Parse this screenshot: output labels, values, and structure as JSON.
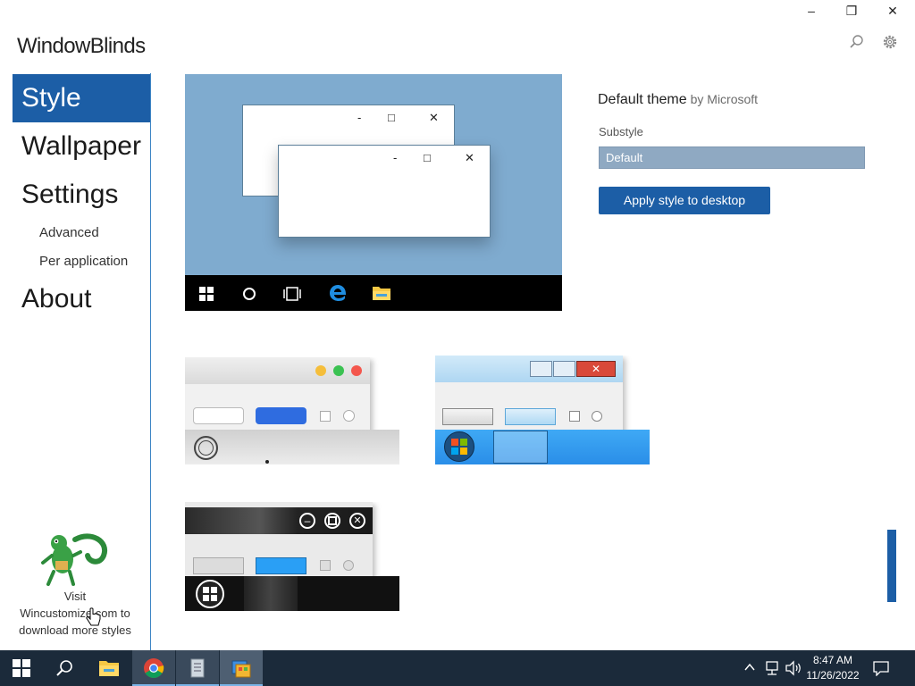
{
  "app": {
    "title": "WindowBlinds"
  },
  "window_controls": {
    "minimize": "–",
    "maximize": "❐",
    "close": "✕"
  },
  "sidebar": {
    "items": [
      {
        "label": "Style",
        "active": true
      },
      {
        "label": "Wallpaper"
      },
      {
        "label": "Settings"
      },
      {
        "label": "Advanced"
      },
      {
        "label": "Per application"
      },
      {
        "label": "About"
      }
    ],
    "promo": {
      "line1": "Visit",
      "line2": "Wincustomize.com to",
      "line3": "download more styles"
    }
  },
  "theme": {
    "name": "Default theme",
    "author": "by Microsoft",
    "substyle_label": "Substyle",
    "substyle_value": "Default",
    "apply_label": "Apply style to desktop"
  },
  "preview_controls": {
    "minimize": "-",
    "maximize": "□",
    "close": "✕"
  },
  "taskbar": {
    "time": "8:47 AM",
    "date": "11/26/2022",
    "buttons": [
      "start-icon",
      "search-icon",
      "file-explorer-icon",
      "chrome-icon",
      "notepad-icon",
      "windowblinds-icon"
    ]
  },
  "colors": {
    "accent": "#1c5ea6",
    "preview_bg": "#7fabcf",
    "taskbar_bg": "#1b2a3a"
  }
}
